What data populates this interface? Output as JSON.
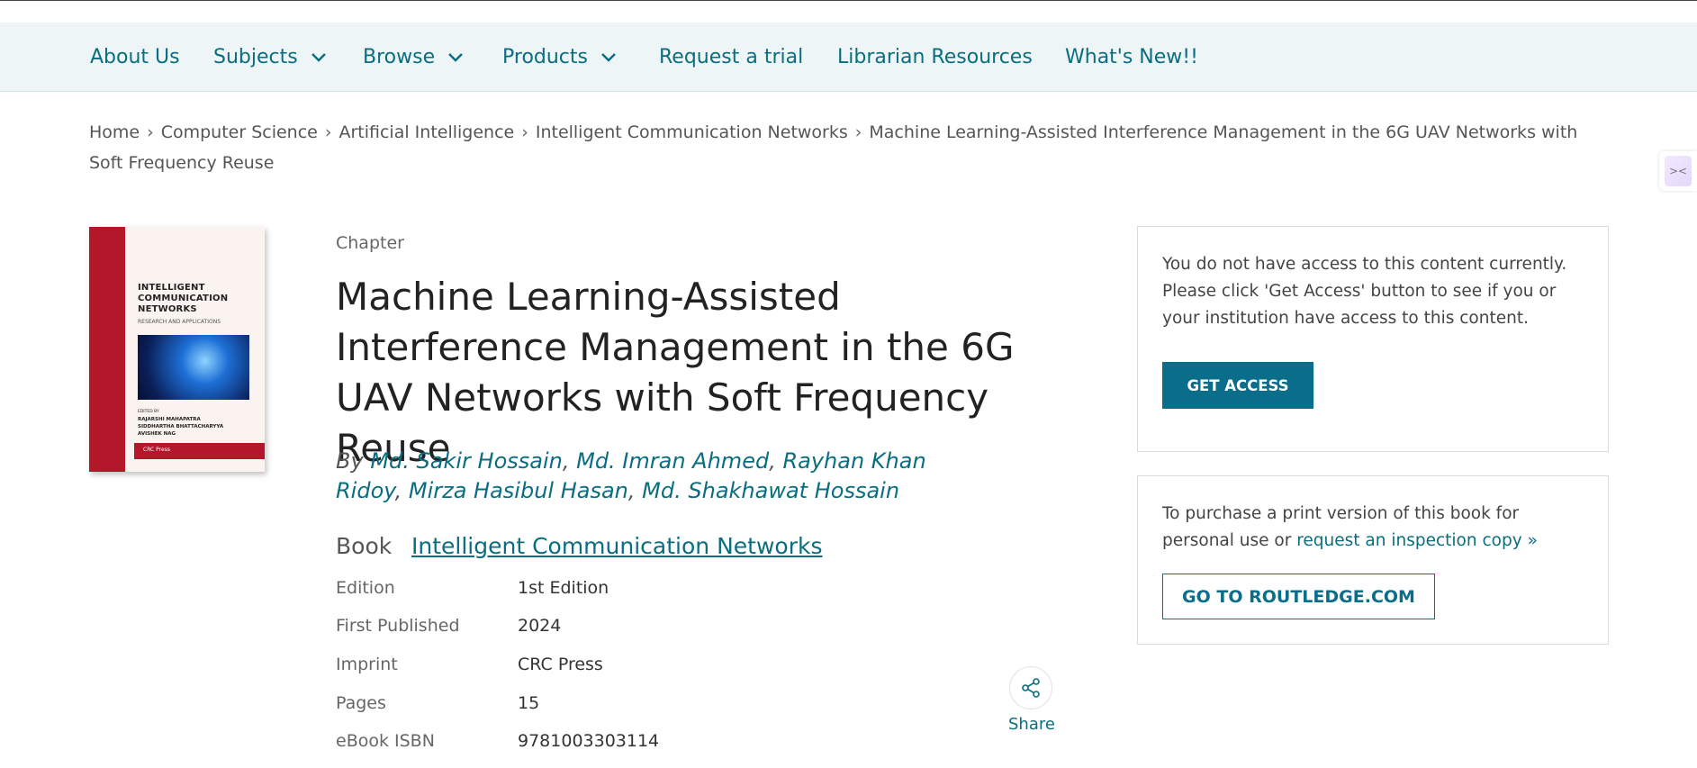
{
  "nav": {
    "about": "About Us",
    "subjects": "Subjects",
    "browse": "Browse",
    "products": "Products",
    "trial": "Request a trial",
    "librarian": "Librarian Resources",
    "whatsnew": "What's New!!"
  },
  "breadcrumb": {
    "home": "Home",
    "cs": "Computer Science",
    "ai": "Artificial Intelligence",
    "book": "Intelligent Communication Networks",
    "current": "Machine Learning-Assisted Interference Management in the 6G UAV Networks with Soft Frequency Reuse"
  },
  "cover": {
    "title_line1": "INTELLIGENT",
    "title_line2": "COMMUNICATION",
    "title_line3": "NETWORKS",
    "subtitle": "RESEARCH AND APPLICATIONS",
    "edited_by": "EDITED BY",
    "editor1": "RAJARSHI MAHAPATRA",
    "editor2": "SIDDHARTHA BHATTACHARYYA",
    "editor3": "AVISHEK NAG",
    "publisher": "CRC Press"
  },
  "chapter": {
    "type_label": "Chapter",
    "title": "Machine Learning-Assisted Interference Management in the 6G UAV Networks with Soft Frequency Reuse",
    "by": "By",
    "authors": [
      "Md. Sakir Hossain",
      "Md. Imran Ahmed",
      "Rayhan Khan Ridoy",
      "Mirza Hasibul Hasan",
      "Md. Shakhawat Hossain"
    ]
  },
  "book": {
    "label": "Book",
    "title": "Intelligent Communication Networks"
  },
  "meta": [
    {
      "key": "Edition",
      "value": "1st Edition"
    },
    {
      "key": "First Published",
      "value": "2024"
    },
    {
      "key": "Imprint",
      "value": "CRC Press"
    },
    {
      "key": "Pages",
      "value": "15"
    },
    {
      "key": "eBook ISBN",
      "value": "9781003303114"
    }
  ],
  "share": {
    "label": "Share"
  },
  "access_box": {
    "text": "You do not have access to this content currently. Please click 'Get Access' button to see if you or your institution have access to this content.",
    "button": "GET ACCESS"
  },
  "purchase_box": {
    "text": "To purchase a print version of this book for personal use or",
    "link": "request an inspection copy",
    "link_suffix": "»",
    "button": "GO TO ROUTLEDGE.COM"
  },
  "colors": {
    "brand_teal": "#0a6e80",
    "button_teal": "#0a6e8a",
    "nav_bg": "#eef5f6",
    "cover_red": "#b5172a"
  }
}
